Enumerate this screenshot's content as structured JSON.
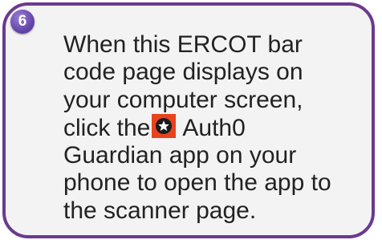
{
  "step": {
    "number": "6"
  },
  "instruction": {
    "line1": "When this ERCOT bar",
    "line2": "code page displays on",
    "line3": "your computer screen,",
    "line4_before_icon": "click the",
    "line4_after_icon": "Auth0",
    "line5": "Guardian app on your",
    "line6": "phone to open the app to",
    "line7": "the scanner page."
  },
  "icons": {
    "app_icon": "auth0-guardian-app-icon"
  },
  "colors": {
    "border": "#6b3a8e",
    "background": "#f4f3f3",
    "badge": "#6a4bb0",
    "app_icon_bg": "#e8431e"
  }
}
